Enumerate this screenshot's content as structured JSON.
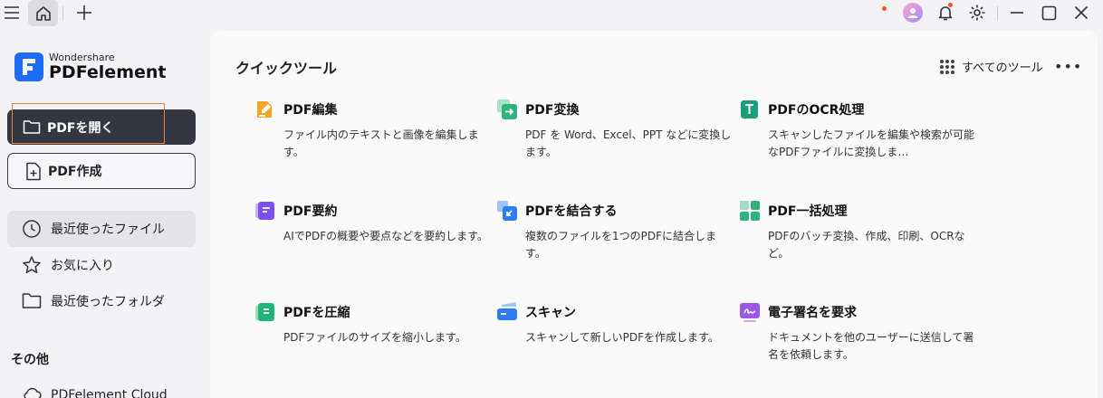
{
  "colors": {
    "accent": "#1f6cf4",
    "dark_button": "#343642",
    "focus_outline": "#e98136",
    "notification_dot": "#f0552b"
  },
  "titlebar": {
    "menu_icon": "hamburger-icon",
    "home_icon": "home-icon",
    "new_tab_icon": "plus-icon",
    "notification_icon": "bell-icon",
    "settings_icon": "gear-icon",
    "window_controls": [
      "minimize-icon",
      "maximize-icon",
      "close-icon"
    ]
  },
  "logo": {
    "brand": "Wondershare",
    "product": "PDFelement"
  },
  "sidebar": {
    "open_pdf": "PDFを開く",
    "create_pdf": "PDF作成",
    "nav": [
      {
        "label": "最近使ったファイル",
        "icon": "clock-icon",
        "active": true
      },
      {
        "label": "お気に入り",
        "icon": "star-icon",
        "active": false
      },
      {
        "label": "最近使ったフォルダ",
        "icon": "folder-icon",
        "active": false
      }
    ],
    "section_other": "その他",
    "cloud": "PDFelement Cloud"
  },
  "main": {
    "title": "クイックツール",
    "all_tools": "すべてのツール",
    "tools": [
      {
        "title": "PDF編集",
        "desc": "ファイル内のテキストと画像を編集します。",
        "icon": "edit-pdf-icon"
      },
      {
        "title": "PDF変換",
        "desc": "PDF を Word、Excel、PPT などに変換します。",
        "icon": "convert-pdf-icon"
      },
      {
        "title": "PDFのOCR処理",
        "desc": "スキャンしたファイルを編集や検索が可能なPDFファイルに変換しま…",
        "icon": "ocr-icon"
      },
      {
        "title": "PDF要約",
        "desc": "AIでPDFの概要や要点などを要約します。",
        "icon": "summarize-icon"
      },
      {
        "title": "PDFを結合する",
        "desc": "複数のファイルを1つのPDFに結合します。",
        "icon": "combine-icon"
      },
      {
        "title": "PDF一括処理",
        "desc": "PDFのバッチ変換、作成、印刷、OCRなど。",
        "icon": "batch-icon"
      },
      {
        "title": "PDFを圧縮",
        "desc": "PDFファイルのサイズを縮小します。",
        "icon": "compress-icon"
      },
      {
        "title": "スキャン",
        "desc": "スキャンして新しいPDFを作成します。",
        "icon": "scan-icon"
      },
      {
        "title": "電子署名を要求",
        "desc": "ドキュメントを他のユーザーに送信して署名を依頼します。",
        "icon": "esign-icon"
      }
    ]
  }
}
